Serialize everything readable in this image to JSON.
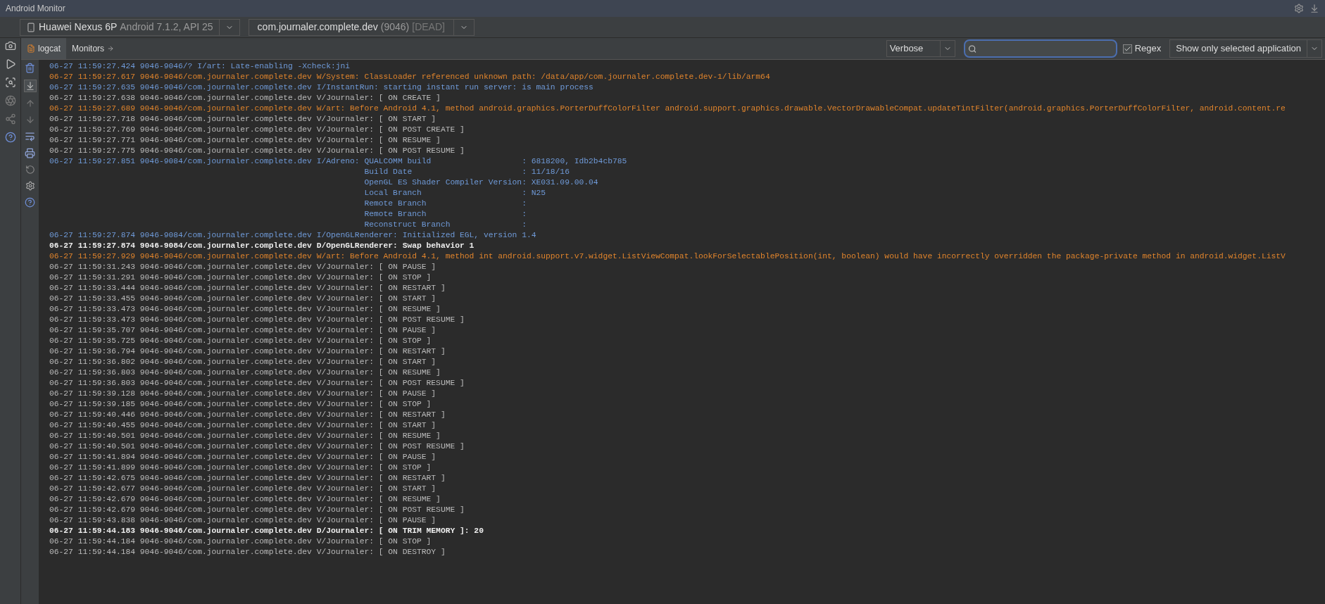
{
  "window": {
    "title": "Android Monitor"
  },
  "device_selector": {
    "device": "Huawei Nexus 6P",
    "detail": "Android 7.1.2, API 25"
  },
  "process_selector": {
    "package": "com.journaler.complete.dev",
    "pid": "(9046)",
    "status": "[DEAD]"
  },
  "tabs": [
    {
      "label": "logcat",
      "selected": true
    },
    {
      "label": "Monitors",
      "selected": false
    }
  ],
  "log_level": {
    "value": "Verbose"
  },
  "regex": {
    "label": "Regex",
    "checked": true
  },
  "filter": {
    "value": "Show only selected application"
  },
  "log": [
    {
      "kind": "info",
      "text": "06-27 11:59:27.424 9046-9046/? I/art: Late-enabling -Xcheck:jni"
    },
    {
      "kind": "warn",
      "text": "06-27 11:59:27.617 9046-9046/com.journaler.complete.dev W/System: ClassLoader referenced unknown path: /data/app/com.journaler.complete.dev-1/lib/arm64"
    },
    {
      "kind": "info",
      "text": "06-27 11:59:27.635 9046-9046/com.journaler.complete.dev I/InstantRun: starting instant run server: is main process"
    },
    {
      "kind": "verbose",
      "text": "06-27 11:59:27.638 9046-9046/com.journaler.complete.dev V/Journaler: [ ON CREATE ]"
    },
    {
      "kind": "warn",
      "text": "06-27 11:59:27.689 9046-9046/com.journaler.complete.dev W/art: Before Android 4.1, method android.graphics.PorterDuffColorFilter android.support.graphics.drawable.VectorDrawableCompat.updateTintFilter(android.graphics.PorterDuffColorFilter, android.content.re"
    },
    {
      "kind": "verbose",
      "text": "06-27 11:59:27.718 9046-9046/com.journaler.complete.dev V/Journaler: [ ON START ]"
    },
    {
      "kind": "verbose",
      "text": "06-27 11:59:27.769 9046-9046/com.journaler.complete.dev V/Journaler: [ ON POST CREATE ]"
    },
    {
      "kind": "verbose",
      "text": "06-27 11:59:27.771 9046-9046/com.journaler.complete.dev V/Journaler: [ ON RESUME ]"
    },
    {
      "kind": "verbose",
      "text": "06-27 11:59:27.775 9046-9046/com.journaler.complete.dev V/Journaler: [ ON POST RESUME ]"
    },
    {
      "kind": "info",
      "text": "06-27 11:59:27.851 9046-9084/com.journaler.complete.dev I/Adreno: QUALCOMM build                   : 6818200, Idb2b4cb785",
      "details": [
        "Build Date                       : 11/18/16",
        "OpenGL ES Shader Compiler Version: XE031.09.00.04",
        "Local Branch                     : N25",
        "Remote Branch                    :",
        "Remote Branch                    :",
        "Reconstruct Branch               :"
      ]
    },
    {
      "kind": "info",
      "text": "06-27 11:59:27.874 9046-9084/com.journaler.complete.dev I/OpenGLRenderer: Initialized EGL, version 1.4"
    },
    {
      "kind": "debug",
      "text": "06-27 11:59:27.874 9046-9084/com.journaler.complete.dev D/OpenGLRenderer: Swap behavior 1"
    },
    {
      "kind": "warn",
      "text": "06-27 11:59:27.929 9046-9046/com.journaler.complete.dev W/art: Before Android 4.1, method int android.support.v7.widget.ListViewCompat.lookForSelectablePosition(int, boolean) would have incorrectly overridden the package-private method in android.widget.ListV"
    },
    {
      "kind": "verbose",
      "text": "06-27 11:59:31.243 9046-9046/com.journaler.complete.dev V/Journaler: [ ON PAUSE ]"
    },
    {
      "kind": "verbose",
      "text": "06-27 11:59:31.291 9046-9046/com.journaler.complete.dev V/Journaler: [ ON STOP ]"
    },
    {
      "kind": "verbose",
      "text": "06-27 11:59:33.444 9046-9046/com.journaler.complete.dev V/Journaler: [ ON RESTART ]"
    },
    {
      "kind": "verbose",
      "text": "06-27 11:59:33.455 9046-9046/com.journaler.complete.dev V/Journaler: [ ON START ]"
    },
    {
      "kind": "verbose",
      "text": "06-27 11:59:33.473 9046-9046/com.journaler.complete.dev V/Journaler: [ ON RESUME ]"
    },
    {
      "kind": "verbose",
      "text": "06-27 11:59:33.473 9046-9046/com.journaler.complete.dev V/Journaler: [ ON POST RESUME ]"
    },
    {
      "kind": "verbose",
      "text": "06-27 11:59:35.707 9046-9046/com.journaler.complete.dev V/Journaler: [ ON PAUSE ]"
    },
    {
      "kind": "verbose",
      "text": "06-27 11:59:35.725 9046-9046/com.journaler.complete.dev V/Journaler: [ ON STOP ]"
    },
    {
      "kind": "verbose",
      "text": "06-27 11:59:36.794 9046-9046/com.journaler.complete.dev V/Journaler: [ ON RESTART ]"
    },
    {
      "kind": "verbose",
      "text": "06-27 11:59:36.802 9046-9046/com.journaler.complete.dev V/Journaler: [ ON START ]"
    },
    {
      "kind": "verbose",
      "text": "06-27 11:59:36.803 9046-9046/com.journaler.complete.dev V/Journaler: [ ON RESUME ]"
    },
    {
      "kind": "verbose",
      "text": "06-27 11:59:36.803 9046-9046/com.journaler.complete.dev V/Journaler: [ ON POST RESUME ]"
    },
    {
      "kind": "verbose",
      "text": "06-27 11:59:39.128 9046-9046/com.journaler.complete.dev V/Journaler: [ ON PAUSE ]"
    },
    {
      "kind": "verbose",
      "text": "06-27 11:59:39.185 9046-9046/com.journaler.complete.dev V/Journaler: [ ON STOP ]"
    },
    {
      "kind": "verbose",
      "text": "06-27 11:59:40.446 9046-9046/com.journaler.complete.dev V/Journaler: [ ON RESTART ]"
    },
    {
      "kind": "verbose",
      "text": "06-27 11:59:40.455 9046-9046/com.journaler.complete.dev V/Journaler: [ ON START ]"
    },
    {
      "kind": "verbose",
      "text": "06-27 11:59:40.501 9046-9046/com.journaler.complete.dev V/Journaler: [ ON RESUME ]"
    },
    {
      "kind": "verbose",
      "text": "06-27 11:59:40.501 9046-9046/com.journaler.complete.dev V/Journaler: [ ON POST RESUME ]"
    },
    {
      "kind": "verbose",
      "text": "06-27 11:59:41.894 9046-9046/com.journaler.complete.dev V/Journaler: [ ON PAUSE ]"
    },
    {
      "kind": "verbose",
      "text": "06-27 11:59:41.899 9046-9046/com.journaler.complete.dev V/Journaler: [ ON STOP ]"
    },
    {
      "kind": "verbose",
      "text": "06-27 11:59:42.675 9046-9046/com.journaler.complete.dev V/Journaler: [ ON RESTART ]"
    },
    {
      "kind": "verbose",
      "text": "06-27 11:59:42.677 9046-9046/com.journaler.complete.dev V/Journaler: [ ON START ]"
    },
    {
      "kind": "verbose",
      "text": "06-27 11:59:42.679 9046-9046/com.journaler.complete.dev V/Journaler: [ ON RESUME ]"
    },
    {
      "kind": "verbose",
      "text": "06-27 11:59:42.679 9046-9046/com.journaler.complete.dev V/Journaler: [ ON POST RESUME ]"
    },
    {
      "kind": "verbose",
      "text": "06-27 11:59:43.838 9046-9046/com.journaler.complete.dev V/Journaler: [ ON PAUSE ]"
    },
    {
      "kind": "debug",
      "text": "06-27 11:59:44.183 9046-9046/com.journaler.complete.dev D/Journaler: [ ON TRIM MEMORY ]: 20"
    },
    {
      "kind": "verbose",
      "text": "06-27 11:59:44.184 9046-9046/com.journaler.complete.dev V/Journaler: [ ON STOP ]"
    },
    {
      "kind": "verbose",
      "text": "06-27 11:59:44.184 9046-9046/com.journaler.complete.dev V/Journaler: [ ON DESTROY ]"
    }
  ]
}
